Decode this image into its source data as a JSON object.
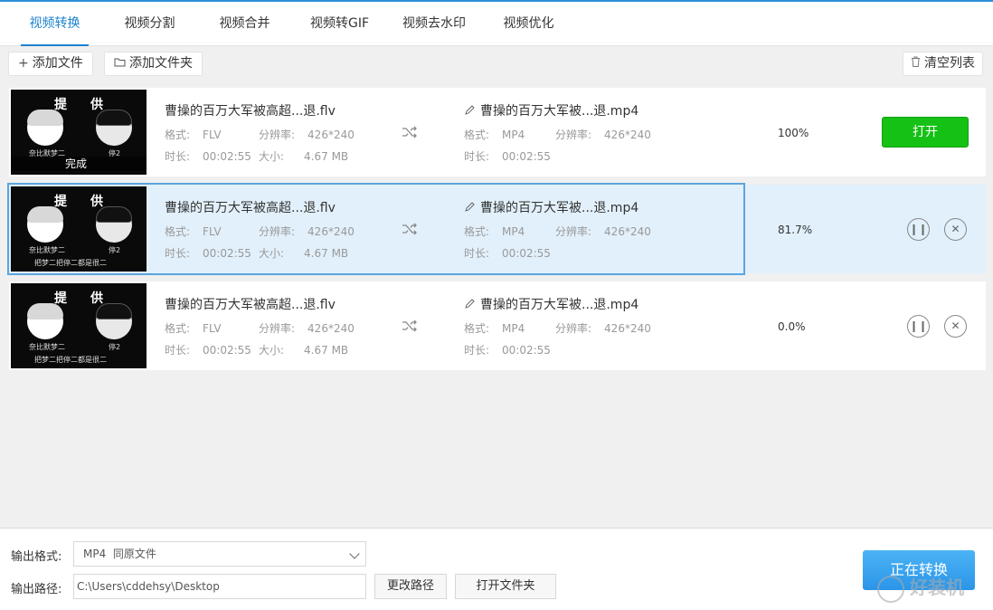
{
  "tabs": [
    {
      "label": "视频转换",
      "active": true
    },
    {
      "label": "视频分割"
    },
    {
      "label": "视频合并"
    },
    {
      "label": "视频转GIF"
    },
    {
      "label": "视频去水印"
    },
    {
      "label": "视频优化"
    }
  ],
  "toolbar": {
    "add_file": "添加文件",
    "add_folder": "添加文件夹",
    "clear_list": "清空列表"
  },
  "labels": {
    "format": "格式:",
    "resolution": "分辨率:",
    "duration": "时长:",
    "size": "大小:"
  },
  "thumbnail": {
    "top_left": "提",
    "top_right": "供",
    "caption_left": "奈比默梦二",
    "caption_right": "停2",
    "caption_bottom": "把梦二把停二都是很二",
    "done_overlay": "完成"
  },
  "rows": [
    {
      "source_name": "曹操的百万大军被高超...退.flv",
      "source_format": "FLV",
      "source_resolution": "426*240",
      "source_duration": "00:02:55",
      "source_size": "4.67 MB",
      "target_name": "曹操的百万大军被...退.mp4",
      "target_format": "MP4",
      "target_resolution": "426*240",
      "target_duration": "00:02:55",
      "progress": "100%",
      "action": "打开",
      "done": true
    },
    {
      "source_name": "曹操的百万大军被高超...退.flv",
      "source_format": "FLV",
      "source_resolution": "426*240",
      "source_duration": "00:02:55",
      "source_size": "4.67 MB",
      "target_name": "曹操的百万大军被...退.mp4",
      "target_format": "MP4",
      "target_resolution": "426*240",
      "target_duration": "00:02:55",
      "progress": "81.7%",
      "selected": true
    },
    {
      "source_name": "曹操的百万大军被高超...退.flv",
      "source_format": "FLV",
      "source_resolution": "426*240",
      "source_duration": "00:02:55",
      "source_size": "4.67 MB",
      "target_name": "曹操的百万大军被...退.mp4",
      "target_format": "MP4",
      "target_resolution": "426*240",
      "target_duration": "00:02:55",
      "progress": "0.0%"
    }
  ],
  "bottom": {
    "output_format_label": "输出格式:",
    "output_format_value": "MP4  同原文件",
    "output_path_label": "输出路径:",
    "output_path_value": "C:\\Users\\cddehsy\\Desktop",
    "change_path": "更改路径",
    "open_folder": "打开文件夹",
    "convert": "正在转换"
  },
  "watermark": "好装机",
  "colors": {
    "accent": "#1e83cf",
    "open_button": "#16c116",
    "convert_button": "#2b95e8",
    "selected_row": "#e2f0fb"
  }
}
